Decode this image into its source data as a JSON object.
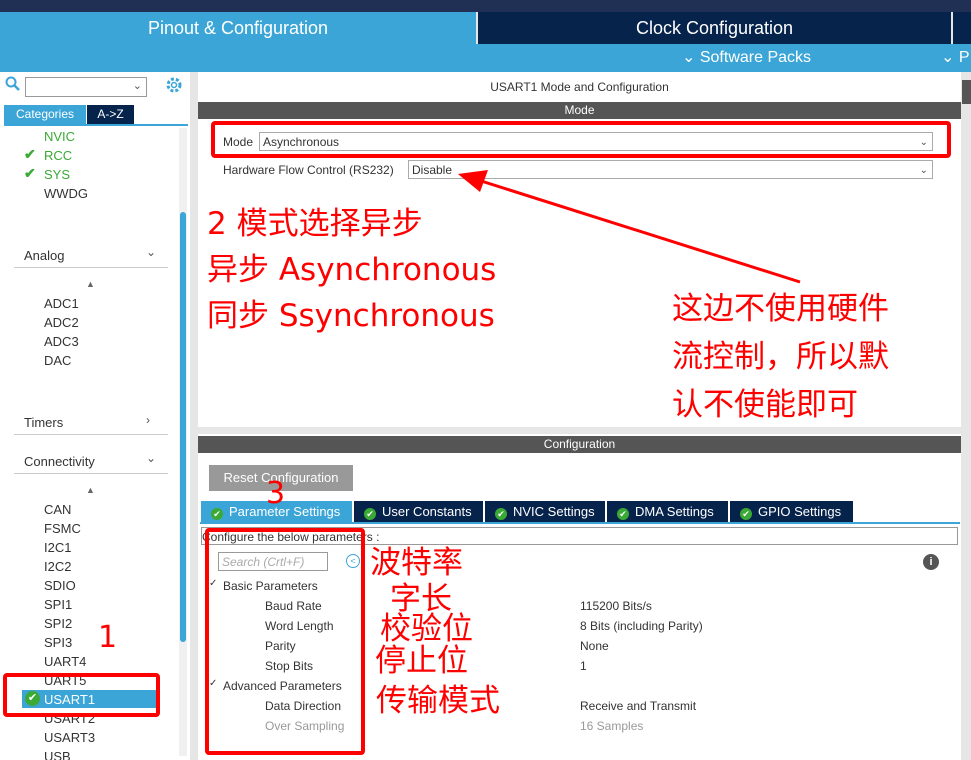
{
  "header": {
    "tab_pinout": "Pinout & Configuration",
    "tab_clock": "Clock Configuration",
    "software_packs": "Software Packs",
    "software_packs_2": "P"
  },
  "sidebar": {
    "tab_categories": "Categories",
    "tab_az": "A->Z",
    "system_items": [
      {
        "label": "NVIC",
        "checked": false,
        "color": "#3aa935"
      },
      {
        "label": "RCC",
        "checked": true,
        "color": "#3aa935"
      },
      {
        "label": "SYS",
        "checked": true,
        "color": "#3aa935"
      },
      {
        "label": "WWDG",
        "checked": false
      }
    ],
    "analog": {
      "label": "Analog",
      "items": [
        "ADC1",
        "ADC2",
        "ADC3",
        "DAC"
      ]
    },
    "timers": {
      "label": "Timers"
    },
    "connectivity": {
      "label": "Connectivity",
      "items": [
        "CAN",
        "FSMC",
        "I2C1",
        "I2C2",
        "SDIO",
        "SPI1",
        "SPI2",
        "SPI3",
        "UART4",
        "UART5",
        "USART1",
        "USART2",
        "USART3",
        "USB"
      ],
      "selected": "USART1"
    }
  },
  "mode": {
    "title": "USART1 Mode and Configuration",
    "section": "Mode",
    "mode_label": "Mode",
    "mode_value": "Asynchronous",
    "hw_flow_label": "Hardware Flow Control (RS232)",
    "hw_flow_value": "Disable"
  },
  "config": {
    "section": "Configuration",
    "reset_button": "Reset Configuration",
    "tabs": [
      "Parameter Settings",
      "User Constants",
      "NVIC Settings",
      "DMA Settings",
      "GPIO Settings"
    ],
    "configure_text": "Configure the below parameters :",
    "search_placeholder": "Search (Crtl+F)",
    "basic_params_label": "Basic Parameters",
    "advanced_params_label": "Advanced Parameters",
    "params": [
      {
        "name": "Baud Rate",
        "value": "115200 Bits/s"
      },
      {
        "name": "Word Length",
        "value": "8 Bits (including Parity)"
      },
      {
        "name": "Parity",
        "value": "None"
      },
      {
        "name": "Stop Bits",
        "value": "1"
      },
      {
        "name": "Data Direction",
        "value": "Receive and Transmit"
      },
      {
        "name": "Over Sampling",
        "value": "16 Samples"
      }
    ]
  },
  "annotations": {
    "num1": "1",
    "num3": "3",
    "mode_note": [
      "2 模式选择异步",
      "异步 Asynchronous",
      "同步 Ssynchronous"
    ],
    "flow_note": [
      "这边不使用硬件",
      "流控制，所以默",
      "认不使能即可"
    ],
    "param_notes": [
      "波特率",
      "字长",
      "校验位",
      "停止位",
      "传输模式"
    ]
  },
  "colors": {
    "accent": "#3ca5d7",
    "navy": "#06234b",
    "annotation": "#ff0000",
    "check": "#3aa935"
  }
}
